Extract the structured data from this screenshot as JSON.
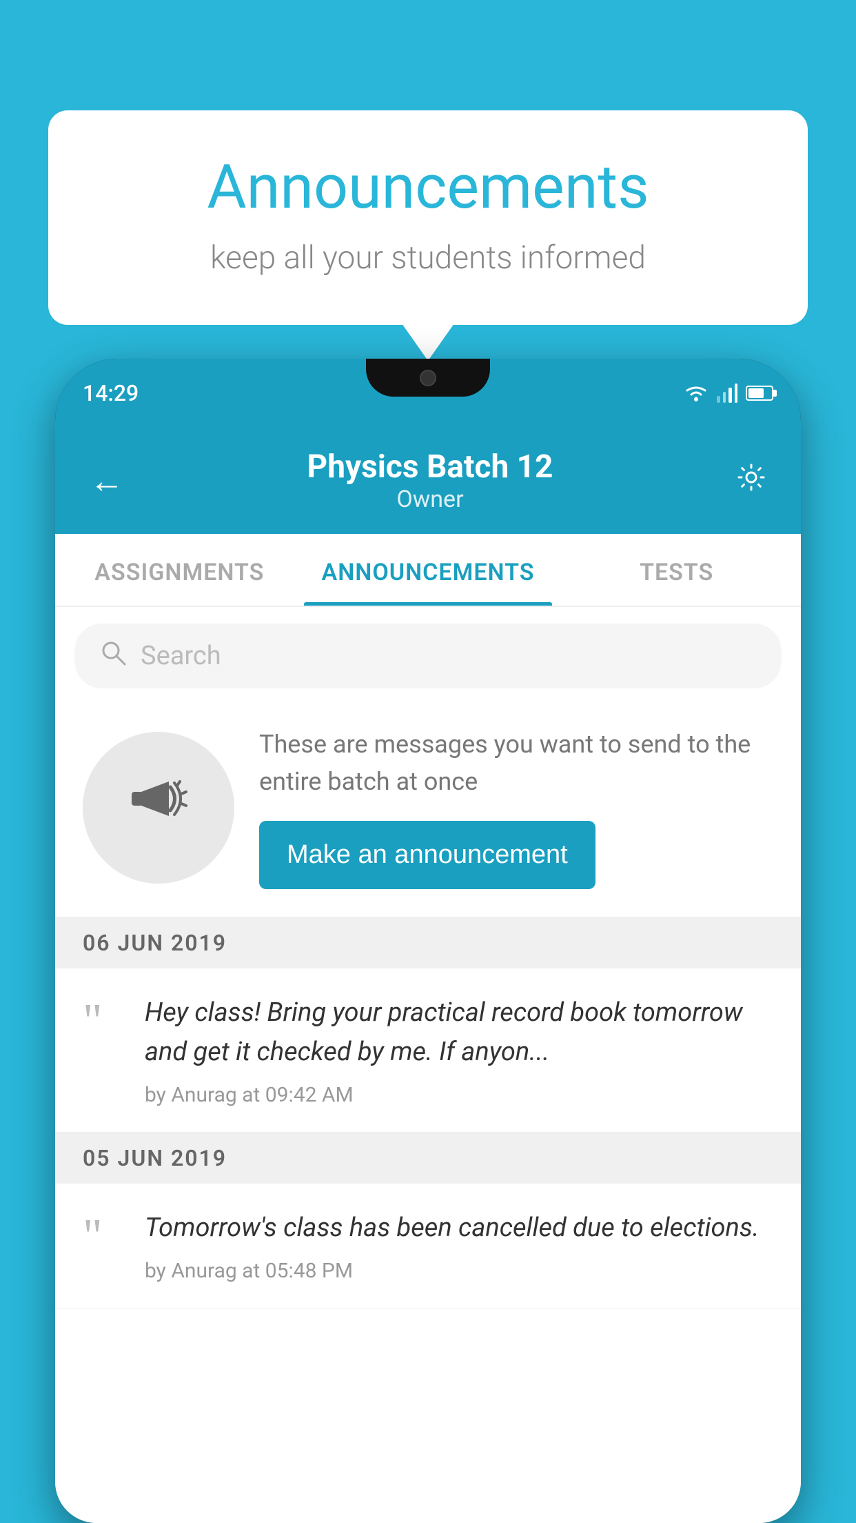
{
  "bubble": {
    "title": "Announcements",
    "subtitle": "keep all your students informed"
  },
  "phone": {
    "status_time": "14:29",
    "header": {
      "title": "Physics Batch 12",
      "subtitle": "Owner",
      "back_label": "←",
      "settings_label": "⚙"
    },
    "tabs": [
      {
        "label": "ASSIGNMENTS",
        "active": false
      },
      {
        "label": "ANNOUNCEMENTS",
        "active": true
      },
      {
        "label": "TESTS",
        "active": false
      },
      {
        "label": "...",
        "active": false
      }
    ],
    "search": {
      "placeholder": "Search"
    },
    "promo": {
      "description": "These are messages you want to send to the entire batch at once",
      "button_label": "Make an announcement"
    },
    "announcements": [
      {
        "date": "06  JUN  2019",
        "text": "Hey class! Bring your practical record book tomorrow and get it checked by me. If anyon...",
        "meta": "by Anurag at 09:42 AM"
      },
      {
        "date": "05  JUN  2019",
        "text": "Tomorrow's class has been cancelled due to elections.",
        "meta": "by Anurag at 05:48 PM"
      }
    ]
  },
  "colors": {
    "accent": "#1a9fc0",
    "background": "#29b6d8"
  }
}
